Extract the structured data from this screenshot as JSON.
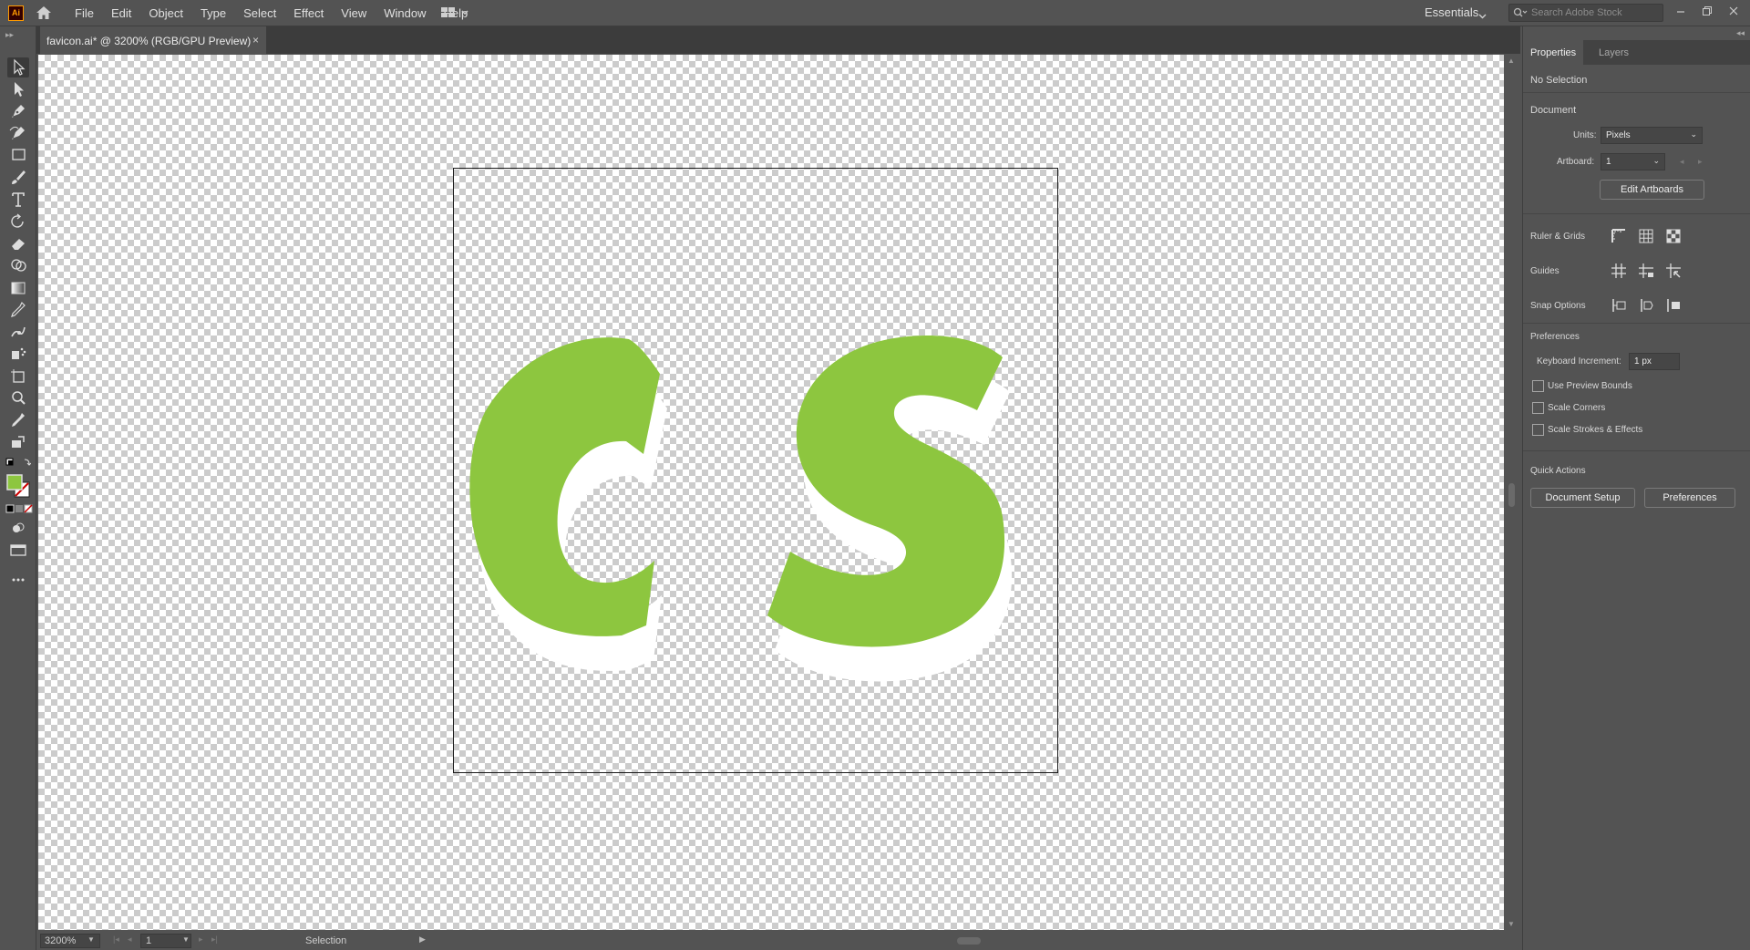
{
  "app": {
    "logo_text": "Ai"
  },
  "menu": {
    "items": [
      "File",
      "Edit",
      "Object",
      "Type",
      "Select",
      "Effect",
      "View",
      "Window",
      "Help"
    ]
  },
  "workspace": {
    "label": "Essentials"
  },
  "search": {
    "placeholder": "Search Adobe Stock"
  },
  "document_tab": {
    "title": "favicon.ai* @ 3200% (RGB/GPU Preview)",
    "close": "×"
  },
  "status": {
    "zoom": "3200%",
    "artboard": "1",
    "current_tool": "Selection"
  },
  "panel": {
    "tabs": [
      "Properties",
      "Layers"
    ],
    "selection_state": "No Selection",
    "document_heading": "Document",
    "units_label": "Units:",
    "units_value": "Pixels",
    "artboard_label": "Artboard:",
    "artboard_value": "1",
    "edit_artboards": "Edit Artboards",
    "ruler_grids": "Ruler & Grids",
    "guides": "Guides",
    "snap_options": "Snap Options",
    "preferences_heading": "Preferences",
    "keyboard_increment_label": "Keyboard Increment:",
    "keyboard_increment_value": "1 px",
    "checkboxes": [
      "Use Preview Bounds",
      "Scale Corners",
      "Scale Strokes & Effects"
    ],
    "quick_actions_heading": "Quick Actions",
    "document_setup": "Document Setup",
    "preferences_button": "Preferences"
  },
  "artwork": {
    "text": "CS",
    "fill_color": "#8dc63f",
    "shadow_color": "#ffffff"
  },
  "colors": {
    "ui_bg": "#535353",
    "dark_bar": "#3c3c3c",
    "fill_swatch": "#8dc63f",
    "stroke_none": "#cc0000"
  },
  "icons": [
    "home-icon",
    "workspace-switcher-icon",
    "search-icon",
    "minimize-icon",
    "restore-icon",
    "close-icon",
    "selection-tool-icon",
    "direct-selection-tool-icon",
    "pen-tool-icon",
    "curvature-tool-icon",
    "rectangle-tool-icon",
    "paintbrush-tool-icon",
    "type-tool-icon",
    "rotate-tool-icon",
    "eraser-tool-icon",
    "shape-builder-tool-icon",
    "gradient-tool-icon",
    "eyedropper-tool-icon",
    "puppet-warp-tool-icon",
    "symbol-sprayer-tool-icon",
    "artboard-tool-icon",
    "zoom-tool-icon",
    "more-tools-icon"
  ]
}
